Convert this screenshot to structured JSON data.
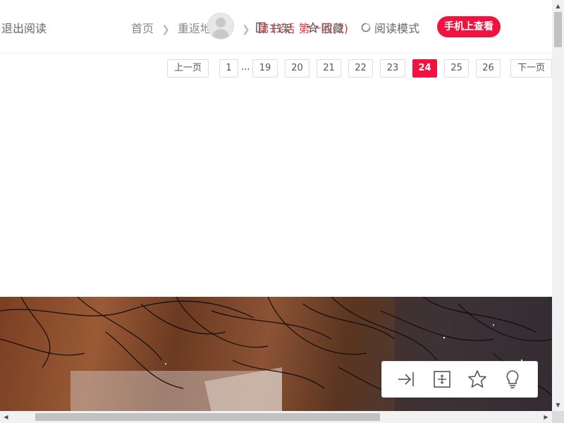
{
  "header": {
    "exit_label": "退出阅读",
    "breadcrumb": {
      "home": "首页",
      "comic": "重返地",
      "chapter": "第11话 第一回(2)"
    },
    "shelf_label": "书架",
    "favorite_label": "收藏",
    "read_mode_label": "阅读模式",
    "mobile_label": "手机上查看"
  },
  "pager": {
    "prev_label": "上一页",
    "next_label": "下一页",
    "ellipsis": "...",
    "pages": [
      "1",
      "19",
      "20",
      "21",
      "22",
      "23",
      "24",
      "25",
      "26"
    ],
    "active_page": "24"
  },
  "colors": {
    "accent": "#f0133f",
    "text": "#666666"
  },
  "toolbar": {
    "icons": [
      "jump-to-end-icon",
      "fit-page-icon",
      "star-icon",
      "lightbulb-icon"
    ]
  }
}
